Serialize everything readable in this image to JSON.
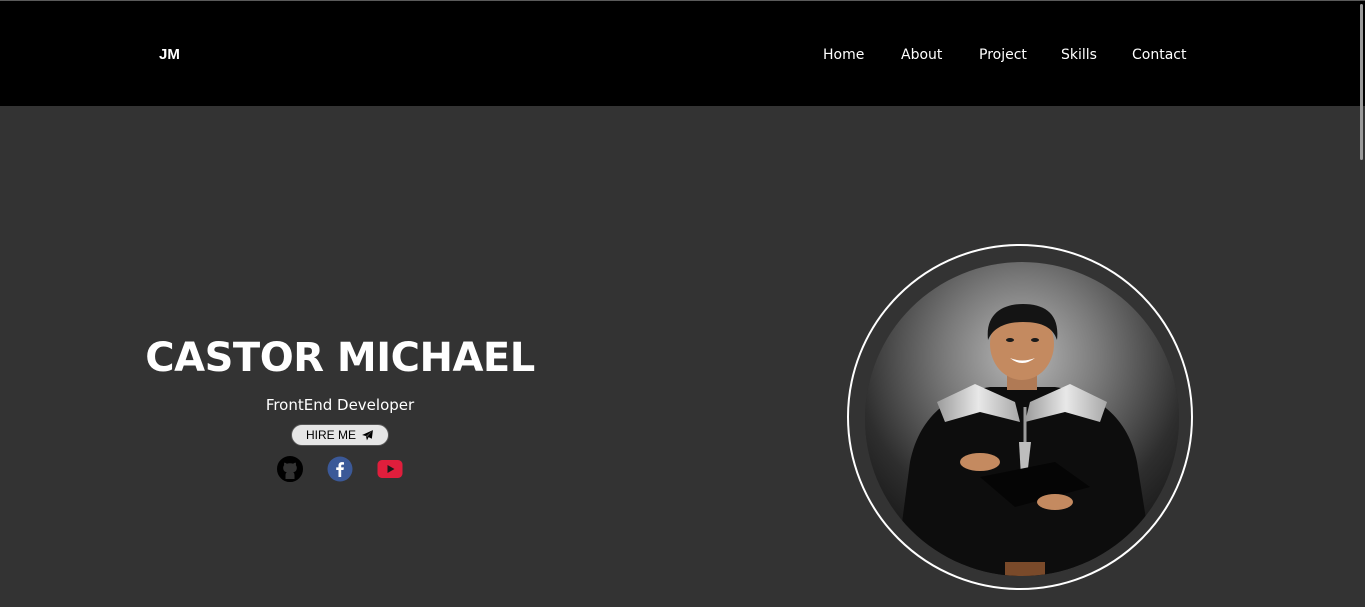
{
  "header": {
    "logo": "JM",
    "nav": [
      {
        "label": "Home"
      },
      {
        "label": "About"
      },
      {
        "label": "Project"
      },
      {
        "label": "Skills"
      },
      {
        "label": "Contact"
      }
    ]
  },
  "hero": {
    "name": "CASTOR MICHAEL",
    "role": "FrontEnd Developer",
    "hire_label": "HIRE ME",
    "hire_icon": "paper-plane-icon",
    "socials": [
      {
        "icon": "github-icon",
        "color": "#000000"
      },
      {
        "icon": "facebook-icon",
        "color": "#3b5998"
      },
      {
        "icon": "youtube-icon",
        "color": "#e01e3c"
      }
    ],
    "photo": "graduation-portrait"
  },
  "colors": {
    "navbar_bg": "#000000",
    "page_bg": "#333333",
    "text": "#ffffff",
    "button_bg": "#e6e6e6"
  }
}
